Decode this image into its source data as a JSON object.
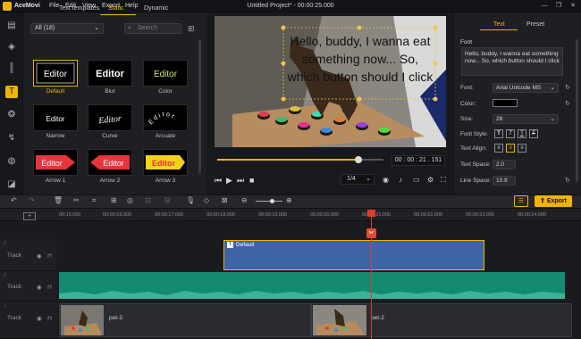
{
  "app": {
    "name": "AceMovi",
    "menu": [
      "File",
      "Edit",
      "View",
      "Export",
      "Help"
    ],
    "project_title": "Untitled Project* - 00:00:25.000",
    "window_controls": [
      "—",
      "❐",
      "✕"
    ]
  },
  "library": {
    "tabs": [
      "Text templates",
      "Static",
      "Dynamic"
    ],
    "active_tab": "Static",
    "filter_value": "All (18)",
    "search_placeholder": "Search",
    "templates": [
      {
        "label": "Default",
        "preview": "Editor"
      },
      {
        "label": "Blur",
        "preview": "Editor"
      },
      {
        "label": "Color",
        "preview": "Editor"
      },
      {
        "label": "Narrow",
        "preview": "Editor"
      },
      {
        "label": "Curve",
        "preview": "Editor"
      },
      {
        "label": "Arcuate",
        "preview": "Editor"
      },
      {
        "label": "Arrow 1",
        "preview": "Editor"
      },
      {
        "label": "Arrow 2",
        "preview": "Editor"
      },
      {
        "label": "Arrow 3",
        "preview": "Editor"
      }
    ],
    "selected_template": "Default"
  },
  "preview": {
    "overlay_text": "Hello, buddy, I wanna eat something now... So, which button should I click",
    "timecode": "00 : 00 : 21 . 151",
    "progress": 0.85,
    "ratio": "1/4"
  },
  "properties": {
    "tabs": [
      "Text",
      "Preset"
    ],
    "active_tab": "Text",
    "section_title": "Font",
    "font_text": "Hello, buddy, I wanna eat something now... So, which button should I click",
    "font_label": "Font:",
    "font_value": "Arial Unicode MS",
    "color_label": "Color:",
    "color_value": "#000000",
    "size_label": "Size:",
    "size_value": "28",
    "font_style_label": "Font Style:",
    "font_style_buttons": [
      "T",
      "T",
      "T",
      "T"
    ],
    "text_align_label": "Text Align:",
    "align_buttons": [
      "≡",
      "≡",
      "≡"
    ],
    "text_space_label": "Text Space:",
    "text_space_value": "2.0",
    "line_space_label": "Line Space:",
    "line_space_value": "10.9"
  },
  "toolbar": {
    "export_label": "Export"
  },
  "timeline": {
    "ticks": [
      "00:15.000",
      "00:00:16.000",
      "00:00:17.000",
      "00:00:18.000",
      "00:00:19.000",
      "00:00:20.000",
      "00:00:21.000",
      "00:00:22.000",
      "00:00:23.000",
      "00:00:24.000"
    ],
    "tracks": [
      {
        "num": "3",
        "name": "Track"
      },
      {
        "num": "2",
        "name": "Track"
      },
      {
        "num": "1",
        "name": "Track"
      }
    ],
    "text_clip_label": "Default",
    "video_clips": [
      "pet-3",
      "pet-2"
    ]
  },
  "colors": {
    "accent": "#f0b400",
    "text_clip": "#3e64a6",
    "audio_clip": "#148a70",
    "playhead": "#e23b2b"
  }
}
